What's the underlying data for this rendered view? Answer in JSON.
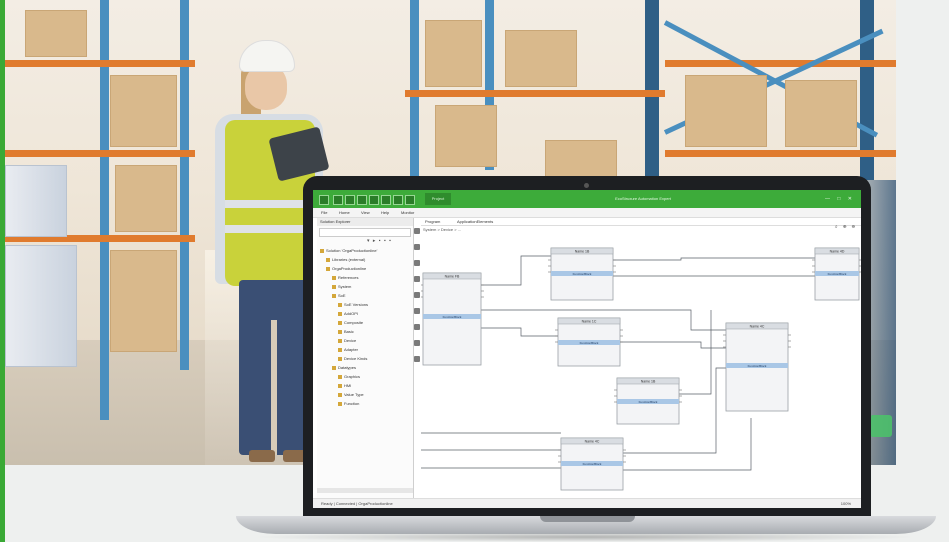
{
  "app": {
    "title": "EcoStruxure Automation Expert",
    "tab": "Project",
    "window_buttons": "— □ ✕",
    "menu": [
      "File",
      "Home",
      "View",
      "Help",
      "Monitor"
    ]
  },
  "explorer": {
    "header": "Solution Explorer",
    "tools": "▾ ▸ ▪ ▪ ▪",
    "items": [
      {
        "label": "Solution 'OrgaProductionline'",
        "indent": 0
      },
      {
        "label": "Libraries (external)",
        "indent": 1
      },
      {
        "label": "OrgaProductionline",
        "indent": 1
      },
      {
        "label": "References",
        "indent": 2
      },
      {
        "label": "System",
        "indent": 2
      },
      {
        "label": "SoE",
        "indent": 2
      },
      {
        "label": "SoE Versions",
        "indent": 3
      },
      {
        "label": "AddOPI",
        "indent": 3
      },
      {
        "label": "Composite",
        "indent": 3
      },
      {
        "label": "Basic",
        "indent": 3
      },
      {
        "label": "Device",
        "indent": 3
      },
      {
        "label": "Adapter",
        "indent": 3
      },
      {
        "label": "Device Kinds",
        "indent": 3
      },
      {
        "label": "Datatypes",
        "indent": 2
      },
      {
        "label": "Graphics",
        "indent": 3
      },
      {
        "label": "HMI",
        "indent": 3
      },
      {
        "label": "Value Type",
        "indent": 3
      },
      {
        "label": "Function",
        "indent": 3
      }
    ]
  },
  "canvas": {
    "tabs": [
      "Program",
      "ApplicationElements"
    ],
    "breadcrumb": "System > Device > ...",
    "tools": "⌕ ⊕ ⊖",
    "blocks": [
      {
        "title": "Name FB",
        "label": "FunctionBlock"
      },
      {
        "title": "Name 1B",
        "label": "FunctionBlock"
      },
      {
        "title": "Name 1C",
        "label": "FunctionBlock"
      },
      {
        "title": "Name 1B",
        "label": "FunctionBlock"
      },
      {
        "title": "Name 4C",
        "label": "FunctionBlock"
      },
      {
        "title": "Name 4D",
        "label": "FunctionBlock"
      },
      {
        "title": "Name 4C",
        "label": "FunctionBlock"
      }
    ]
  },
  "status": {
    "left": "Ready | Connected | OrgaProductionline",
    "right": "100%"
  },
  "colors": {
    "accent": "#3aa935",
    "titlebar": "#3dab3a",
    "block_header": "#d9dde2",
    "block_band": "#a9c7e6"
  }
}
